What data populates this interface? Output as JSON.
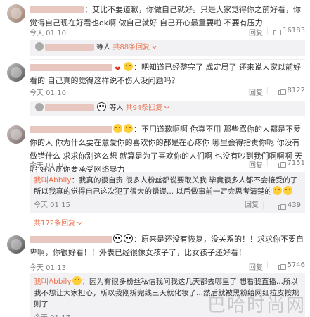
{
  "comments": [
    {
      "text_a": "：艾比不要道歉，你做自己就好。只是大家觉得你之前好看，你觉得自己现在好看也ok啊 做自己就好 自己开心最重要啦 不要有压力",
      "time": "今天 01:10",
      "reply_label": "回复",
      "likes": "16183"
    },
    {
      "text_a": "：吧知道已经整完了 成定局了 还来说人家以前好看的 自己真的觉得这样说不伤人没问题吗？",
      "time": "今天 01:10",
      "reply_label": "回复",
      "likes": "8122"
    },
    {
      "text_a": "：不用道歉啊啊 你真不用 那些骂你的人都是不爱你的人 你为什么要在意爱你的喜欢你的都是在心疼你 哪里会得指责你呢 你没有做错什么 求求你别这么想 就算是为了喜欢你的人们啊 也没有吵到我们啊啊啊 天呢 好心疼你要承受网络暴力",
      "time": "今天 01:10",
      "reply_label": "回复",
      "likes": "7151"
    },
    {
      "text_a": "：原来是还没有恢复，没关系的！！求求你不要自卑啊，你很好看！！外表已经很像女孩子了，比女孩子还好看！",
      "time": "今天 01:13",
      "reply_label": "回复",
      "likes": "5746"
    }
  ],
  "summaries": [
    {
      "suffix": "等人",
      "count": "共88条回复"
    },
    {
      "suffix": "等人",
      "count": "共94条回复"
    }
  ],
  "replies": [
    {
      "user": "我叫Abbily",
      "text": "：我真的很自责 很多人粉丝都说要取关我 毕竟很多人都不会接受的了 所以我真的觉得自己这次犯了很大的错误... 以后做事前一定会思考清楚的",
      "time": "今天 01:15",
      "reply_label": "回复",
      "likes": "439"
    },
    {
      "user": "我叫Abbily",
      "text": "：因为有很多粉丝私信我问我这几天都去哪里了 想看我直播...所以我不想让大家担心，所以我刚拆完线三天就化妆了...然后就被黑粉给网红拉皮按规则了",
      "time": "今天 01:17",
      "reply_label": "回复",
      "likes": ""
    }
  ],
  "more_replies_label": "共172条回复",
  "watermark": "巴哈时尚网"
}
